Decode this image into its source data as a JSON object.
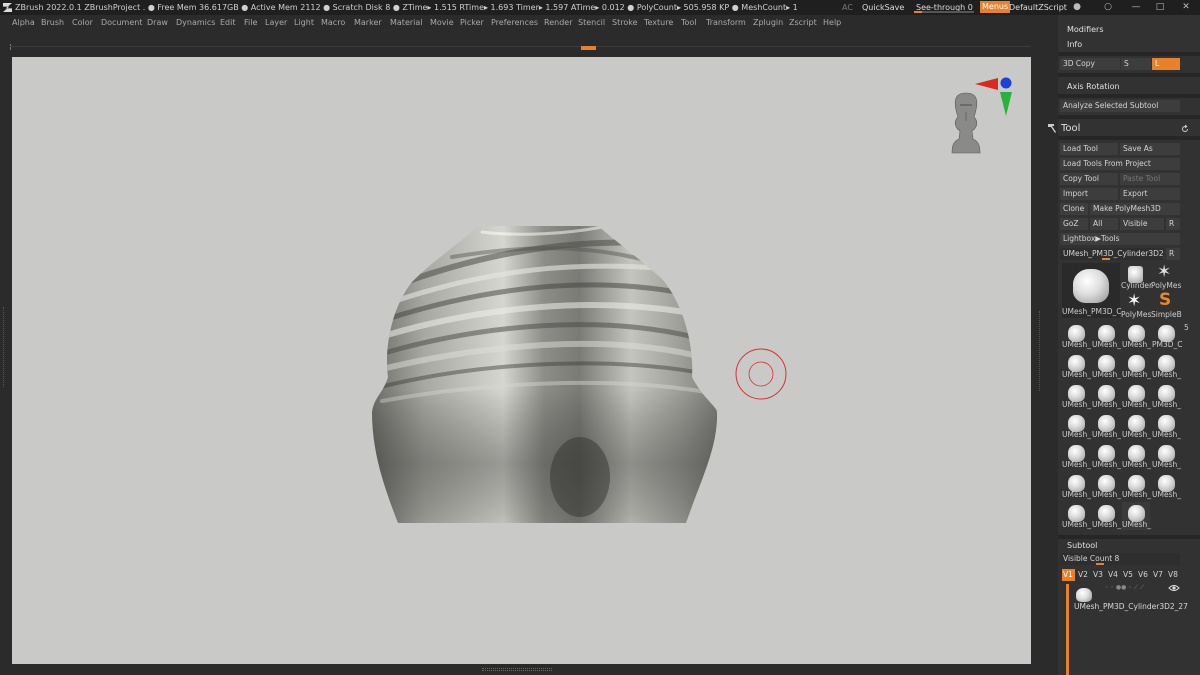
{
  "titlebar": {
    "info": "ZBrush 2022.0.1    ZBrushProject   . ● Free Mem 36.617GB ● Active Mem 2112 ● Scratch Disk 8 ●  ZTime▸ 1.515 RTime▸ 1.693 Timer▸ 1.597 ATime▸ 0.012 ● PolyCount▸ 505.958 KP  ● MeshCount▸ 1",
    "ac": "AC",
    "quicksave": "QuickSave",
    "seethrough": "See-through  0",
    "menus": "Menus",
    "default_zscript": "DefaultZScript",
    "controls": [
      "●",
      "○",
      "—",
      "□",
      "✕"
    ]
  },
  "menubar": [
    "Alpha",
    "Brush",
    "Color",
    "Document",
    "Draw",
    "Dynamics",
    "Edit",
    "File",
    "Layer",
    "Light",
    "Macro",
    "Marker",
    "Material",
    "Movie",
    "Picker",
    "Preferences",
    "Render",
    "Stencil",
    "Stroke",
    "Texture",
    "Tool",
    "Transform",
    "Zplugin",
    "Zscript",
    "Help"
  ],
  "panel": {
    "modifiers": "Modifiers",
    "info": "Info",
    "copy3d": "3D Copy",
    "s_btn": "S",
    "l_btn": "L",
    "axis_rotation": "Axis Rotation",
    "analyze": "Analyze Selected Subtool",
    "tool_title": "Tool",
    "load_tool": "Load Tool",
    "save_as": "Save As",
    "load_from_project": "Load Tools From Project",
    "copy_tool": "Copy Tool",
    "paste_tool": "Paste Tool",
    "import": "Import",
    "export": "Export",
    "clone": "Clone",
    "make_polymesh": "Make PolyMesh3D",
    "goz": "GoZ",
    "all": "All",
    "visible": "Visible",
    "r": "R",
    "lightbox_tools": "Lightbox▶Tools",
    "current_tool": "UMesh_PM3D_Cylinder3D2_27",
    "r2": "R",
    "big_thumb_label": "UMesh_PM3D_C",
    "thumb_cylinder": "Cylinder",
    "thumb_polymesh": "PolyMes",
    "thumb_polymesh2": "PolyMes",
    "thumb_simpleb": "SimpleB",
    "thumb_count": "5",
    "grid_label": "UMesh_",
    "grid_label_alt": "PM3D_C",
    "subtool_title": "Subtool",
    "visible_count": "Visible Count 8",
    "versions": [
      "V1",
      "V2",
      "V3",
      "V4",
      "V5",
      "V6",
      "V7",
      "V8"
    ],
    "subtool_name": "UMesh_PM3D_Cylinder3D2_27"
  }
}
